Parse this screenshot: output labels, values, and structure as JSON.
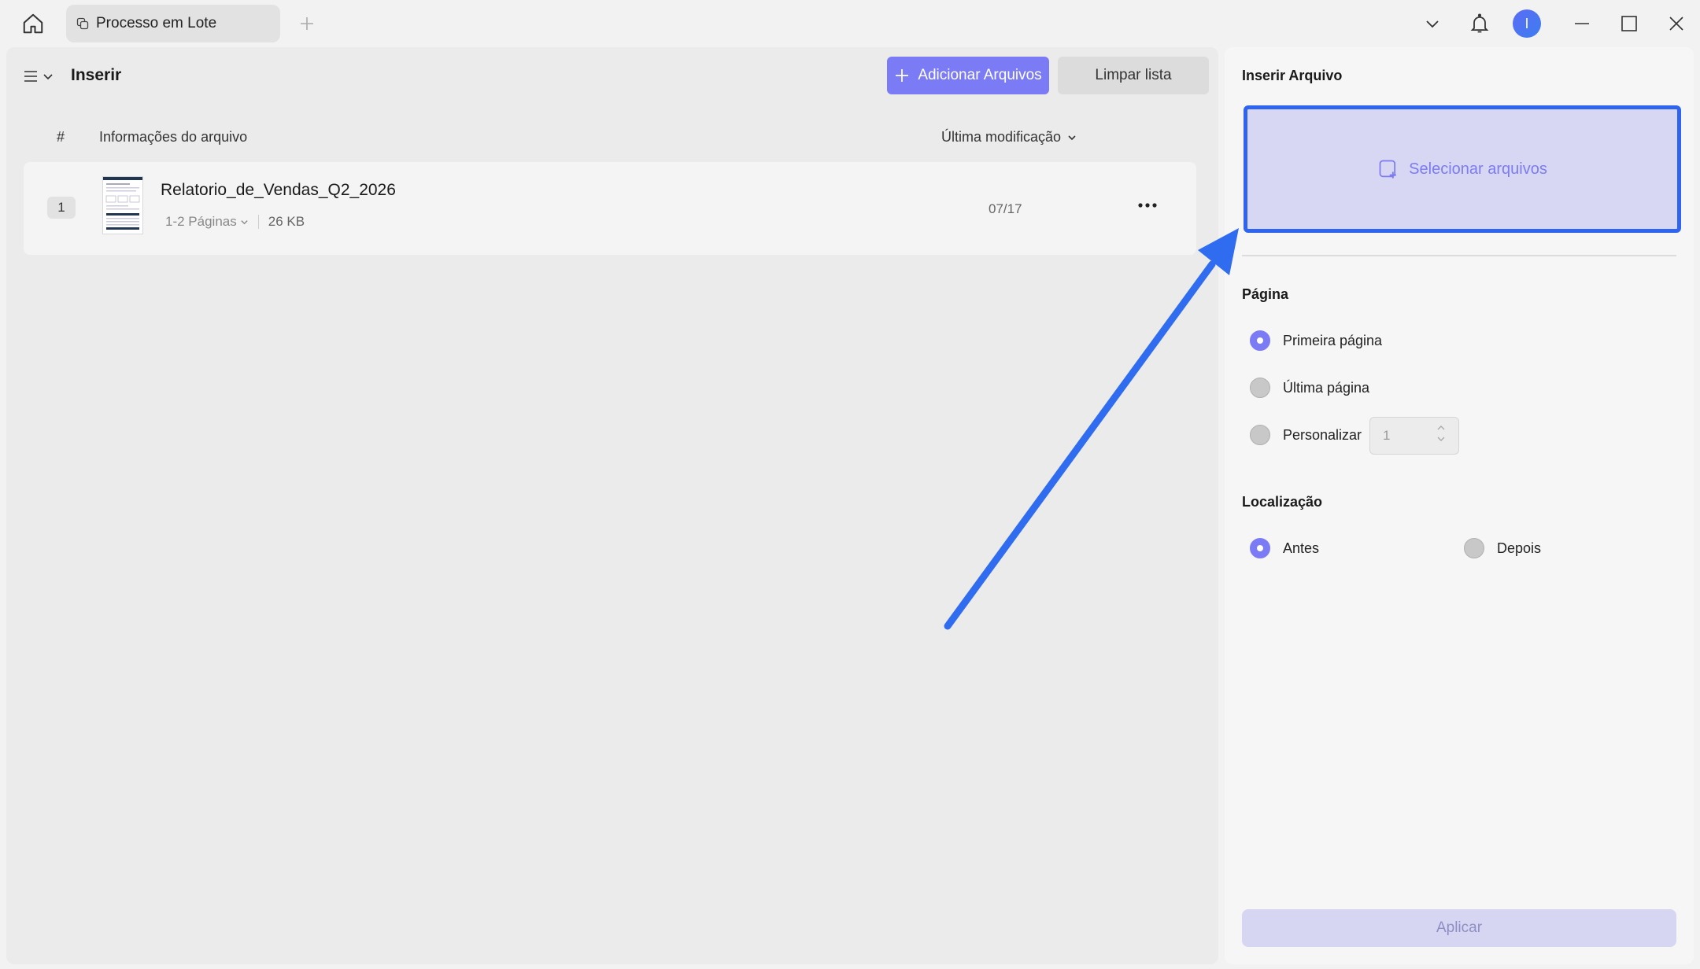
{
  "titlebar": {
    "tab_title": "Processo em Lote",
    "avatar_letter": "I",
    "icons": [
      "home-icon",
      "copy-icon",
      "plus-icon",
      "chevron-down-icon",
      "bell-icon",
      "minimize-icon",
      "maximize-icon",
      "close-icon"
    ]
  },
  "left_panel": {
    "title": "Inserir",
    "add_files_label": "Adicionar Arquivos",
    "clear_list_label": "Limpar lista",
    "columns": {
      "hash": "#",
      "info": "Informações do arquivo",
      "modified": "Última modificação"
    },
    "files": [
      {
        "index": "1",
        "name": "Relatorio_de_Vendas_Q2_2026",
        "pages": "1-2 Páginas",
        "size": "26 KB",
        "date": "07/17"
      }
    ]
  },
  "right_panel": {
    "insert_title": "Inserir Arquivo",
    "select_files_label": "Selecionar arquivos",
    "page_title": "Página",
    "page_options": [
      {
        "label": "Primeira página",
        "selected": true
      },
      {
        "label": "Última página",
        "selected": false
      },
      {
        "label": "Personalizar",
        "selected": false
      }
    ],
    "custom_page_value": "1",
    "location_title": "Localização",
    "location_options": [
      {
        "label": "Antes",
        "selected": true
      },
      {
        "label": "Depois",
        "selected": false
      }
    ],
    "apply_label": "Aplicar"
  },
  "colors": {
    "accent": "#7b7cf5",
    "highlight_border": "#2f64f0",
    "annotation_arrow": "#2f6cf0"
  }
}
